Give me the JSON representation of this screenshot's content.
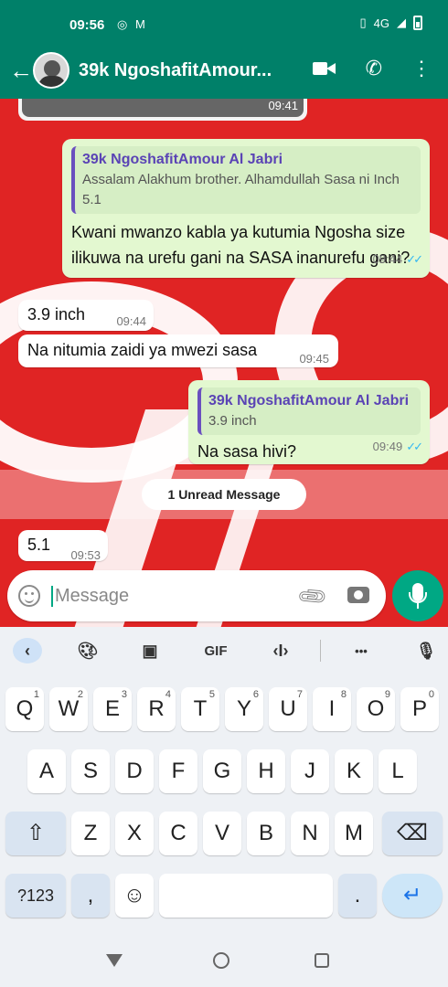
{
  "status_bar": {
    "time": "09:56",
    "icons": [
      "whatsapp-status-icon",
      "gmail-icon",
      "vibrate-icon",
      "4g-signal-icon",
      "signal-icon",
      "battery-icon"
    ],
    "network": "4G"
  },
  "app_bar": {
    "title": "39k NgoshafitAmour...",
    "actions": [
      "video-call-icon",
      "voice-call-icon",
      "more-options-icon"
    ]
  },
  "chat": {
    "partial_image_time": "09:41",
    "messages": [
      {
        "direction": "out",
        "quote_name": "39k NgoshafitAmour Al Jabri",
        "quote_text": "Assalam Alakhum brother. Alhamdullah Sasa ni Inch 5.1",
        "text": "Kwani mwanzo kabla ya kutumia Ngosha size ilikuwa na urefu gani na SASA inanurefu gani?",
        "time": "09:44",
        "ticks": "✓✓"
      },
      {
        "direction": "in",
        "text": "3.9 inch",
        "time": "09:44"
      },
      {
        "direction": "in",
        "text": "Na nitumia zaidi ya mwezi sasa",
        "time": "09:45"
      },
      {
        "direction": "out",
        "quote_name": "39k NgoshafitAmour Al Jabri",
        "quote_text": "3.9 inch",
        "text": "Na sasa hivi?",
        "time": "09:49",
        "ticks": "✓✓"
      },
      {
        "direction": "in",
        "text": "5.1",
        "time": "09:53"
      }
    ],
    "unread_banner": "1 Unread Message"
  },
  "composer": {
    "placeholder": "Message",
    "icons": [
      "emoji-icon",
      "attach-icon",
      "camera-icon",
      "mic-icon"
    ]
  },
  "keyboard": {
    "toolbar": {
      "gif_label": "GIF",
      "more_label": "•••"
    },
    "row1": [
      {
        "k": "Q",
        "sup": "1"
      },
      {
        "k": "W",
        "sup": "2"
      },
      {
        "k": "E",
        "sup": "3"
      },
      {
        "k": "R",
        "sup": "4"
      },
      {
        "k": "T",
        "sup": "5"
      },
      {
        "k": "Y",
        "sup": "6"
      },
      {
        "k": "U",
        "sup": "7"
      },
      {
        "k": "I",
        "sup": "8"
      },
      {
        "k": "O",
        "sup": "9"
      },
      {
        "k": "P",
        "sup": "0"
      }
    ],
    "row2": [
      "A",
      "S",
      "D",
      "F",
      "G",
      "H",
      "J",
      "K",
      "L"
    ],
    "row3": [
      "Z",
      "X",
      "C",
      "V",
      "B",
      "N",
      "M"
    ],
    "symbols_label": "?123",
    "comma_label": ",",
    "period_label": ".",
    "shift_symbol": "⇧",
    "backspace_symbol": "⌫",
    "enter_symbol": "↵",
    "emoji_symbol": "☺"
  }
}
